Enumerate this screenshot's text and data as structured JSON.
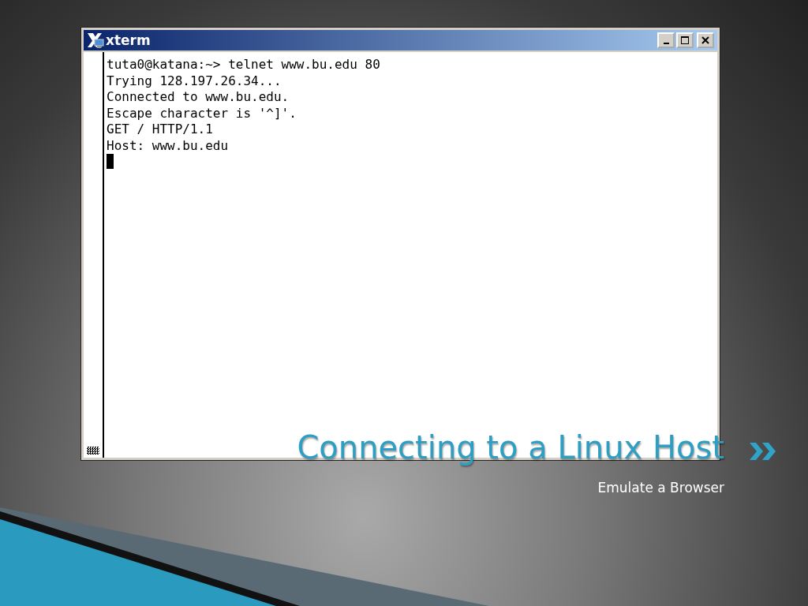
{
  "window": {
    "title": "xterm"
  },
  "terminal": {
    "lines": [
      "tuta0@katana:~> telnet www.bu.edu 80",
      "Trying 128.197.26.34...",
      "Connected to www.bu.edu.",
      "Escape character is '^]'.",
      "GET / HTTP/1.1",
      "Host: www.bu.edu"
    ]
  },
  "slide": {
    "title": "Connecting to a Linux Host",
    "subtitle": "Emulate a Browser"
  }
}
